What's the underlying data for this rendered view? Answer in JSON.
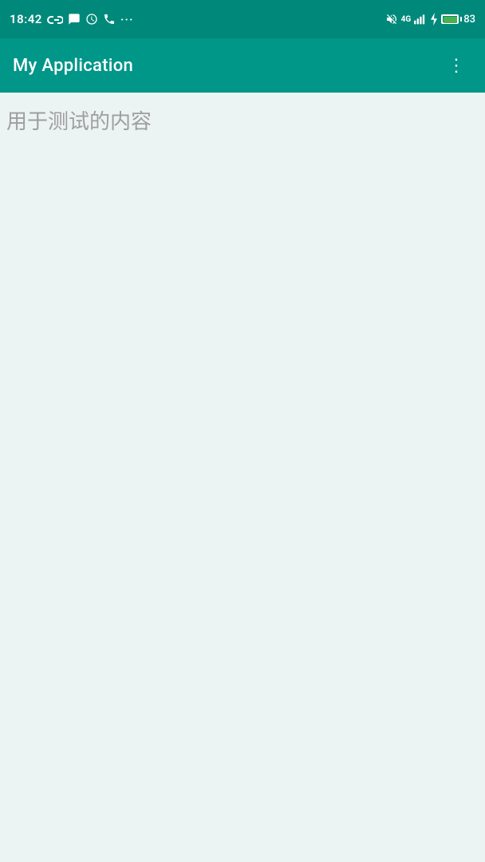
{
  "statusBar": {
    "time": "18:42",
    "batteryLevel": "83",
    "batteryColor": "#4caf50"
  },
  "appBar": {
    "title": "My Application",
    "menuIconLabel": "⋮"
  },
  "content": {
    "text": "用于测试的内容"
  },
  "colors": {
    "statusBar": "#00897b",
    "appBar": "#009688",
    "background": "#ecf4f3",
    "contentText": "#9e9e9e"
  }
}
